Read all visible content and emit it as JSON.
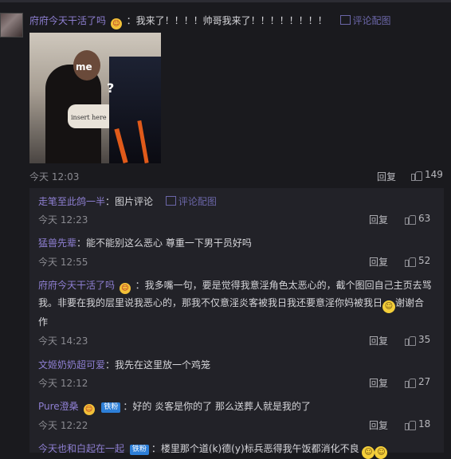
{
  "main_comment": {
    "username": "府府今天干活了吗",
    "text": "：我来了！！！！帅哥我来了！！！！！！！！",
    "pic_comment_link": "评论配图",
    "image_labels": {
      "me": "me",
      "insert": "insert here",
      "question": "?"
    },
    "time": "今天 12:03",
    "reply": "回复",
    "likes": "149"
  },
  "replies": [
    {
      "username": "走笔至此鸽一半",
      "text": "：图片评论",
      "pic_comment_link": "评论配图",
      "time": "今天 12:23",
      "reply": "回复",
      "likes": "63"
    },
    {
      "username": "猛兽先辈",
      "text": "：能不能别这么恶心 尊重一下男干员好吗",
      "time": "今天 12:55",
      "reply": "回复",
      "likes": "52"
    },
    {
      "username": "府府今天干活了吗",
      "text_line1": "：我多嘴一句，要是觉得我意淫角色太恶心的，截个图回自己主页去骂",
      "text_line2": "我。非要在我的层里说我恶心的，那我不仅意淫炎客被我日我还要意淫你妈被我日",
      "text_line2_tail": "谢谢合",
      "text_line3": "作",
      "time": "今天 14:23",
      "reply": "回复",
      "likes": "35"
    },
    {
      "username": "文姬奶奶超可爱",
      "text": "：我先在这里放一个鸡笼",
      "time": "今天 12:12",
      "reply": "回复",
      "likes": "27"
    },
    {
      "username": "Pure澄桑",
      "tag": "铁粉",
      "text": "：好的 炎客是你的了 那么送葬人就是我的了",
      "time": "今天 12:22",
      "reply": "回复",
      "likes": "18"
    },
    {
      "username": "今天也和白起在一起",
      "tag": "铁粉",
      "text": "：楼里那个道(k)德(y)标兵恶得我午饭都消化不良"
    }
  ],
  "icons": [
    "thumb-up-icon",
    "image-icon",
    "emoji-badge-icon",
    "grin-emoji-icon"
  ],
  "colors": {
    "background": "#1a1a1e",
    "username": "#8e7fd2",
    "link": "#6b66a8",
    "tag": "#2d7fd8"
  }
}
